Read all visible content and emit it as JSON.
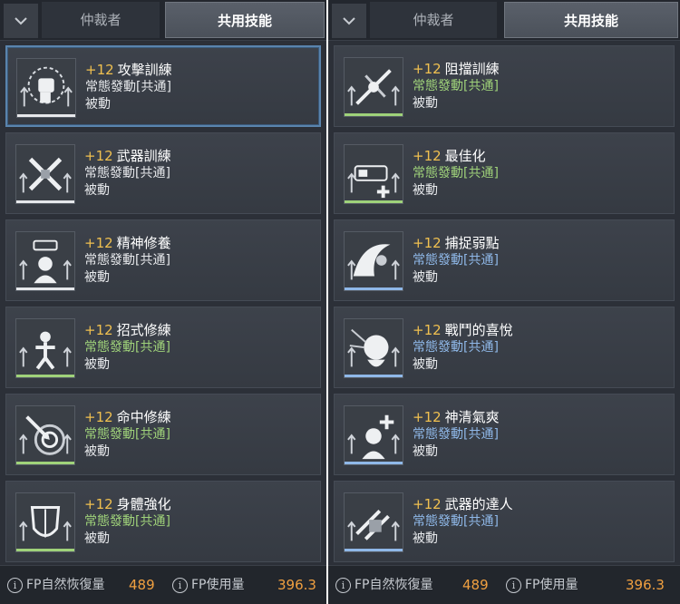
{
  "colors": {
    "gold": "#f0c050",
    "common_white": "#e6e8eb",
    "common_green": "#9fd27a",
    "common_blue": "#8fb8e8",
    "fp_value": "#f0a040"
  },
  "left": {
    "tabs": [
      {
        "label": "仲裁者",
        "active": false
      },
      {
        "label": "共用技能",
        "active": true
      }
    ],
    "skills": [
      {
        "level": "+12",
        "name": "攻擊訓練",
        "subtitle": "常態發動[共通]",
        "type": "被動",
        "color": "#e6e8eb",
        "icon": "fist-icon",
        "selected": true
      },
      {
        "level": "+12",
        "name": "武器訓練",
        "subtitle": "常態發動[共通]",
        "type": "被動",
        "color": "#e6e8eb",
        "icon": "crossed-weapons-icon",
        "selected": false
      },
      {
        "level": "+12",
        "name": "精神修養",
        "subtitle": "常態發動[共通]",
        "type": "被動",
        "color": "#e6e8eb",
        "icon": "meditation-head-icon",
        "selected": false
      },
      {
        "level": "+12",
        "name": "招式修練",
        "subtitle": "常態發動[共通]",
        "type": "被動",
        "color": "#9fd27a",
        "icon": "martial-figure-icon",
        "selected": false
      },
      {
        "level": "+12",
        "name": "命中修練",
        "subtitle": "常態發動[共通]",
        "type": "被動",
        "color": "#9fd27a",
        "icon": "target-arrow-icon",
        "selected": false
      },
      {
        "level": "+12",
        "name": "身體強化",
        "subtitle": "常態發動[共通]",
        "type": "被動",
        "color": "#9fd27a",
        "icon": "shield-icon",
        "selected": false
      }
    ],
    "footer": {
      "fp_recovery_label": "FP自然恢復量",
      "fp_recovery_value": "489",
      "fp_usage_label": "FP使用量",
      "fp_usage_value": "396.3"
    }
  },
  "right": {
    "tabs": [
      {
        "label": "仲裁者",
        "active": false
      },
      {
        "label": "共用技能",
        "active": true
      }
    ],
    "skills": [
      {
        "level": "+12",
        "name": "阻擋訓練",
        "subtitle": "常態發動[共通]",
        "type": "被動",
        "color": "#9fd27a",
        "icon": "block-blades-icon",
        "selected": false
      },
      {
        "level": "+12",
        "name": "最佳化",
        "subtitle": "常態發動[共通]",
        "type": "被動",
        "color": "#9fd27a",
        "icon": "battery-plus-icon",
        "selected": false
      },
      {
        "level": "+12",
        "name": "捕捉弱點",
        "subtitle": "常態發動[共通]",
        "type": "被動",
        "color": "#8fb8e8",
        "icon": "wave-figure-icon",
        "selected": false
      },
      {
        "level": "+12",
        "name": "戰鬥的喜悅",
        "subtitle": "常態發動[共通]",
        "type": "被動",
        "color": "#8fb8e8",
        "icon": "screaming-head-icon",
        "selected": false
      },
      {
        "level": "+12",
        "name": "神清氣爽",
        "subtitle": "常態發動[共通]",
        "type": "被動",
        "color": "#8fb8e8",
        "icon": "refresh-head-icon",
        "selected": false
      },
      {
        "level": "+12",
        "name": "武器的達人",
        "subtitle": "常態發動[共通]",
        "type": "被動",
        "color": "#8fb8e8",
        "icon": "weapon-master-icon",
        "selected": false
      }
    ],
    "footer": {
      "fp_recovery_label": "FP自然恢復量",
      "fp_recovery_value": "489",
      "fp_usage_label": "FP使用量",
      "fp_usage_value": "396.3"
    }
  }
}
